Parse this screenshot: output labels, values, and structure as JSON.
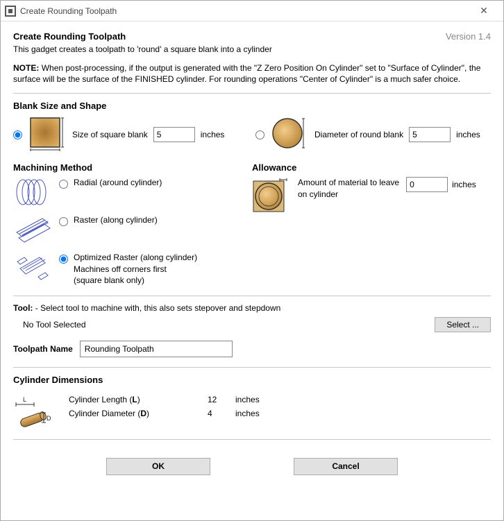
{
  "window": {
    "title": "Create Rounding Toolpath"
  },
  "header": {
    "title": "Create Rounding Toolpath",
    "version": "Version 1.4",
    "subtitle": "This gadget creates a toolpath to 'round' a square blank into a cylinder",
    "note_label": "NOTE:",
    "note_text": "When post-processing, if the output is generated with the \"Z Zero Position On Cylinder\" set to \"Surface of Cylinder\", the surface will be the surface of the FINISHED cylinder. For rounding operations \"Center of Cylinder\" is a much safer choice."
  },
  "blank": {
    "section_title": "Blank Size and Shape",
    "square": {
      "label": "Size of square blank",
      "value": "5",
      "units": "inches",
      "selected": true
    },
    "round": {
      "label": "Diameter of round blank",
      "value": "5",
      "units": "inches",
      "selected": false
    }
  },
  "method": {
    "section_title": "Machining Method",
    "radial": {
      "label": "Radial (around cylinder)",
      "selected": false
    },
    "raster": {
      "label": "Raster (along cylinder)",
      "selected": false
    },
    "optimized": {
      "label": "Optimized Raster (along cylinder)",
      "sub1": "Machines off corners first",
      "sub2": "(square blank only)",
      "selected": true
    }
  },
  "allowance": {
    "section_title": "Allowance",
    "label1": "Amount of material to leave",
    "label2": "on cylinder",
    "value": "0",
    "units": "inches"
  },
  "tool": {
    "label": "Tool:",
    "desc": "- Select tool to machine with, this also sets stepover and stepdown",
    "status": "No Tool Selected",
    "select_button": "Select ..."
  },
  "toolpath_name": {
    "label": "Toolpath Name",
    "value": "Rounding Toolpath"
  },
  "cylinder": {
    "section_title": "Cylinder Dimensions",
    "length_label": "Cylinder Length (",
    "length_bold": "L",
    "length_close": ")",
    "diameter_label": "Cylinder Diameter (",
    "diameter_bold": "D",
    "diameter_close": ")",
    "length_value": "12",
    "diameter_value": "4",
    "units": "inches"
  },
  "buttons": {
    "ok": "OK",
    "cancel": "Cancel"
  }
}
